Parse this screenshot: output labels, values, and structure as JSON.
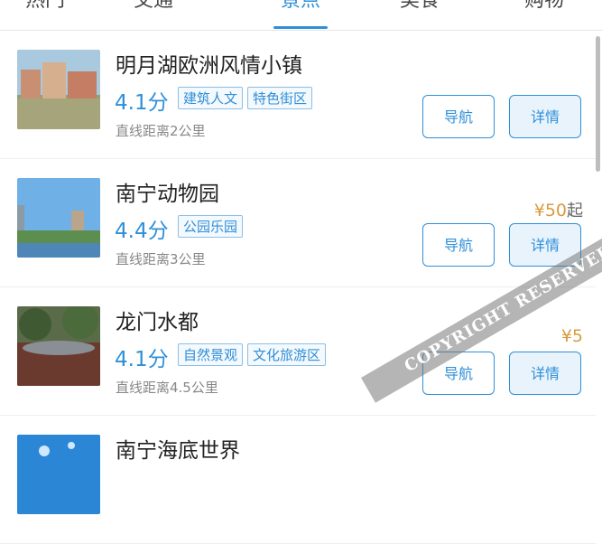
{
  "tabs": [
    {
      "label": "热门",
      "active": false
    },
    {
      "label": "交通",
      "active": false
    },
    {
      "label": "景点",
      "active": true
    },
    {
      "label": "美食",
      "active": false
    },
    {
      "label": "购物",
      "active": false
    }
  ],
  "colors": {
    "accent": "#2f8fd8",
    "price": "#d99b3d"
  },
  "attractions": [
    {
      "name": "明月湖欧洲风情小镇",
      "score": "4.1分",
      "tags": [
        "建筑人文",
        "特色街区"
      ],
      "distance": "直线距离2公里",
      "price": "",
      "price_suffix": "",
      "nav_label": "导航",
      "detail_label": "详情"
    },
    {
      "name": "南宁动物园",
      "score": "4.4分",
      "tags": [
        "公园乐园"
      ],
      "distance": "直线距离3公里",
      "price": "¥50",
      "price_suffix": "起",
      "nav_label": "导航",
      "detail_label": "详情"
    },
    {
      "name": "龙门水都",
      "score": "4.1分",
      "tags": [
        "自然景观",
        "文化旅游区"
      ],
      "distance": "直线距离4.5公里",
      "price": "¥5",
      "price_suffix": "",
      "nav_label": "导航",
      "detail_label": "详情"
    },
    {
      "name": "南宁海底世界",
      "score": "",
      "tags": [],
      "distance": "",
      "price": "",
      "price_suffix": "",
      "nav_label": "",
      "detail_label": ""
    }
  ],
  "watermark": "COPYRIGHT RESERVED"
}
